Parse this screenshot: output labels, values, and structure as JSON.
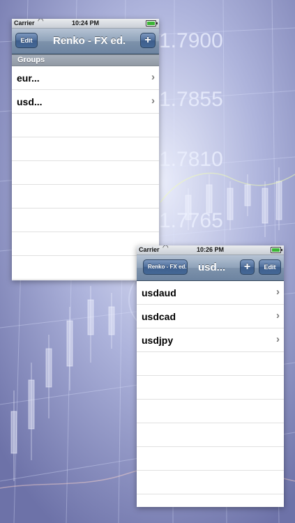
{
  "screen1": {
    "status": {
      "carrier": "Carrier",
      "time": "10:24 PM"
    },
    "navbar": {
      "edit_label": "Edit",
      "title": "Renko - FX ed.",
      "add_label": "+"
    },
    "section_header": "Groups",
    "rows": [
      {
        "label": "eur..."
      },
      {
        "label": "usd..."
      }
    ]
  },
  "screen2": {
    "status": {
      "carrier": "Carrier",
      "time": "10:26 PM"
    },
    "navbar": {
      "back_label": "Renko - FX ed.",
      "title": "usd...",
      "add_label": "+",
      "edit_label": "Edit"
    },
    "rows": [
      {
        "label": "usdaud"
      },
      {
        "label": "usdcad"
      },
      {
        "label": "usdjpy"
      }
    ]
  },
  "background": {
    "axis_labels": [
      "1.7900",
      "1.7855",
      "1.7810",
      "1.7765"
    ]
  },
  "colors": {
    "navbar": "#7d92ab",
    "button": "#4d6d9a",
    "battery": "#3bb535",
    "background": "#8f95c4"
  }
}
